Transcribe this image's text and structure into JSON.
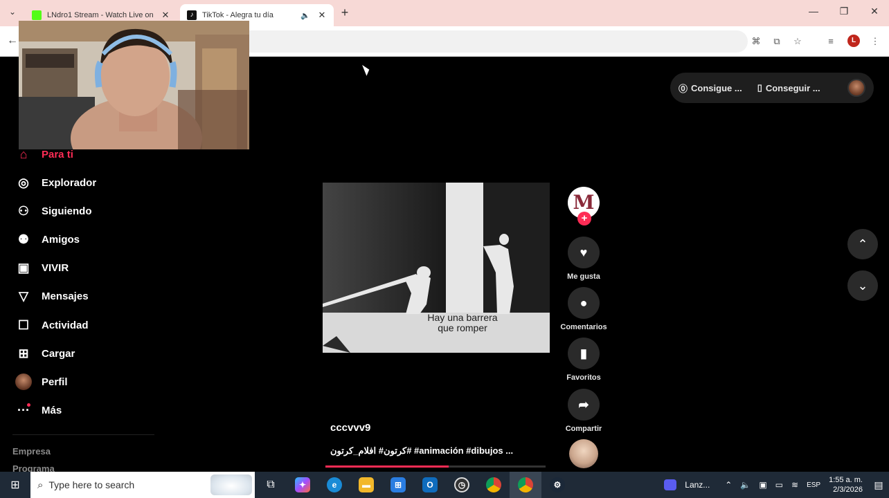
{
  "browser": {
    "tabs": [
      {
        "title": "LNdro1 Stream - Watch Live on",
        "close": "✕",
        "favicon_color": "#53fc18"
      },
      {
        "title": "TikTok - Alegra tu día",
        "close": "✕",
        "favicon_color": "#111111",
        "audio_icon": "speaker-icon"
      }
    ],
    "new_tab": "+",
    "window_controls": {
      "minimize": "—",
      "maximize": "❐",
      "close": "✕"
    },
    "profile_initial": "L"
  },
  "sidebar": {
    "items": [
      {
        "label": "Para ti",
        "icon": "home-icon",
        "active": true
      },
      {
        "label": "Explorador",
        "icon": "compass-icon"
      },
      {
        "label": "Siguiendo",
        "icon": "user-follow-icon"
      },
      {
        "label": "Amigos",
        "icon": "friends-icon"
      },
      {
        "label": "VIVIR",
        "icon": "live-tv-icon"
      },
      {
        "label": "Mensajes",
        "icon": "send-icon"
      },
      {
        "label": "Actividad",
        "icon": "activity-icon"
      },
      {
        "label": "Cargar",
        "icon": "upload-icon"
      },
      {
        "label": "Perfil",
        "icon": "profile-avatar"
      },
      {
        "label": "Más",
        "icon": "more-icon"
      }
    ],
    "footer": [
      "Empresa",
      "Programa"
    ]
  },
  "topbar": {
    "get_coins": "Consigue ...",
    "get_app": "Conseguir ..."
  },
  "video": {
    "caption_line1": "Hay una barrera",
    "caption_line2": "que romper",
    "username": "cccvvv9",
    "description": "كرتون# افلام_كرتون# #animación #dibujos ...",
    "progress": 0.56,
    "creator_initial": "M",
    "follow_symbol": "+"
  },
  "actions": [
    {
      "label": "Me gusta",
      "icon": "heart-icon"
    },
    {
      "label": "Comentarios",
      "icon": "comment-icon"
    },
    {
      "label": "Favoritos",
      "icon": "bookmark-icon"
    },
    {
      "label": "Compartir",
      "icon": "share-icon"
    }
  ],
  "taskbar": {
    "search_placeholder": "Type here to search",
    "launcher_label": "Lanz...",
    "language": "ESP",
    "time": "1:55 a. m.",
    "date": "2/3/2026"
  },
  "colors": {
    "accent": "#fe2c55",
    "background": "#000000",
    "tab_strip": "#f7d9d6",
    "taskbar": "#1f2a37"
  }
}
